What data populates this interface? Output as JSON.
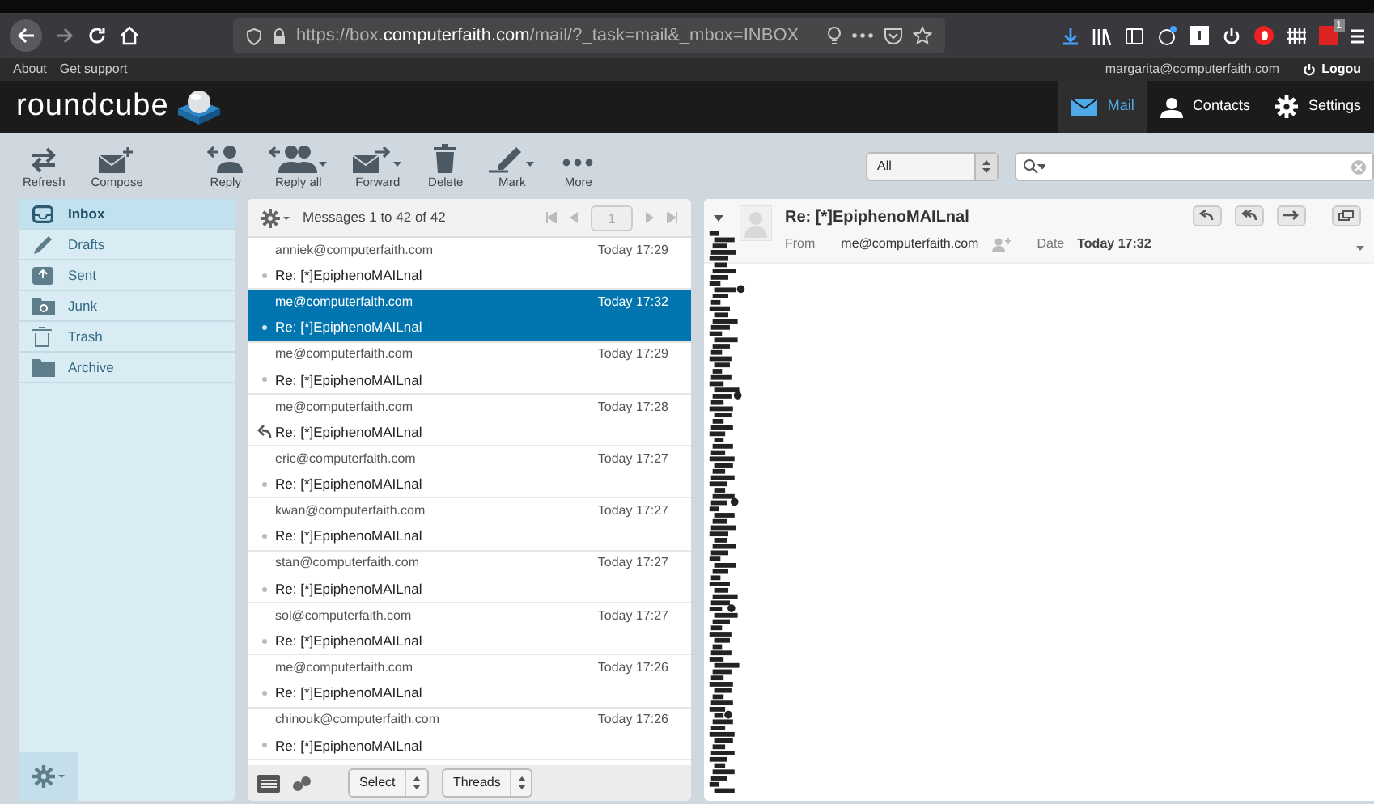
{
  "browser": {
    "url": "https://box.**computerfaith.com**/mail/?_task=mail&_mbox=INBOX",
    "extension_badge": "1"
  },
  "topbar": {
    "links": [
      "About",
      "Get support"
    ],
    "user": "margarita@computerfaith.com",
    "logout": "Logou"
  },
  "header": {
    "logo": "roundcube",
    "nav": [
      {
        "label": "Mail",
        "kind": "mail",
        "selected": true
      },
      {
        "label": "Contacts",
        "kind": "contacts",
        "selected": false
      },
      {
        "label": "Settings",
        "kind": "settings",
        "selected": false
      }
    ]
  },
  "toolbar": {
    "buttons": [
      {
        "label": "Refresh",
        "kind": "refresh",
        "dropdown": false
      },
      {
        "label": "Compose",
        "kind": "compose",
        "dropdown": false
      },
      {
        "label": "Reply",
        "kind": "reply",
        "dropdown": false
      },
      {
        "label": "Reply all",
        "kind": "replyall",
        "dropdown": true
      },
      {
        "label": "Forward",
        "kind": "forward",
        "dropdown": true
      },
      {
        "label": "Delete",
        "kind": "delete",
        "dropdown": false
      },
      {
        "label": "Mark",
        "kind": "mark",
        "dropdown": true
      },
      {
        "label": "More",
        "kind": "more",
        "dropdown": false
      }
    ],
    "filter": "All"
  },
  "folders": [
    {
      "label": "Inbox",
      "kind": "inbox",
      "selected": true
    },
    {
      "label": "Drafts",
      "kind": "drafts",
      "selected": false
    },
    {
      "label": "Sent",
      "kind": "sent",
      "selected": false
    },
    {
      "label": "Junk",
      "kind": "junk",
      "selected": false
    },
    {
      "label": "Trash",
      "kind": "trash",
      "selected": false
    },
    {
      "label": "Archive",
      "kind": "archive",
      "selected": false
    }
  ],
  "message_list": {
    "count": "Messages 1 to 42 of 42",
    "page": "1",
    "messages": [
      {
        "from": "anniek@computerfaith.com",
        "date": "Today 17:29",
        "subject": "Re: [*]EpiphenoMAILnal",
        "selected": false,
        "replied": false
      },
      {
        "from": "me@computerfaith.com",
        "date": "Today 17:32",
        "subject": "Re: [*]EpiphenoMAILnal",
        "selected": true,
        "replied": false
      },
      {
        "from": "me@computerfaith.com",
        "date": "Today 17:29",
        "subject": "Re: [*]EpiphenoMAILnal",
        "selected": false,
        "replied": false
      },
      {
        "from": "me@computerfaith.com",
        "date": "Today 17:28",
        "subject": "Re: [*]EpiphenoMAILnal",
        "selected": false,
        "replied": true
      },
      {
        "from": "eric@computerfaith.com",
        "date": "Today 17:27",
        "subject": "Re: [*]EpiphenoMAILnal",
        "selected": false,
        "replied": false
      },
      {
        "from": "kwan@computerfaith.com",
        "date": "Today 17:27",
        "subject": "Re: [*]EpiphenoMAILnal",
        "selected": false,
        "replied": false
      },
      {
        "from": "stan@computerfaith.com",
        "date": "Today 17:27",
        "subject": "Re: [*]EpiphenoMAILnal",
        "selected": false,
        "replied": false
      },
      {
        "from": "sol@computerfaith.com",
        "date": "Today 17:27",
        "subject": "Re: [*]EpiphenoMAILnal",
        "selected": false,
        "replied": false
      },
      {
        "from": "me@computerfaith.com",
        "date": "Today 17:26",
        "subject": "Re: [*]EpiphenoMAILnal",
        "selected": false,
        "replied": false
      },
      {
        "from": "chinouk@computerfaith.com",
        "date": "Today 17:26",
        "subject": "Re: [*]EpiphenoMAILnal",
        "selected": false,
        "replied": false
      }
    ],
    "select": "Select",
    "threads": "Threads"
  },
  "preview": {
    "subject": "Re: [*]EpiphenoMAILnal",
    "from_label": "From",
    "from": "me@computerfaith.com",
    "date_label": "Date",
    "date": "Today 17:32"
  }
}
